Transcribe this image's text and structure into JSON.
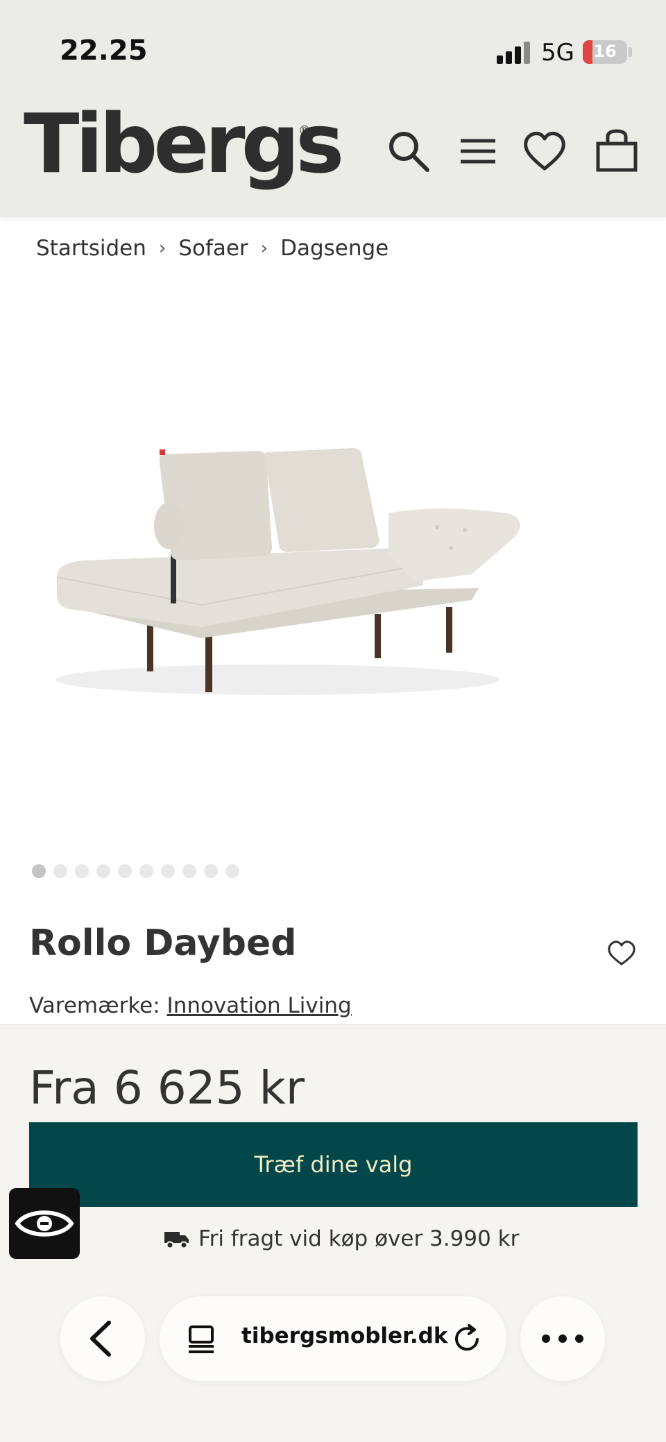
{
  "status_bar": {
    "time": "22.25",
    "network": "5G",
    "battery": "16"
  },
  "header": {
    "logo": "Tibergs",
    "logo_mark": "®"
  },
  "breadcrumb": [
    "Startsiden",
    "Sofaer",
    "Dagsenge"
  ],
  "product": {
    "title": "Rollo Daybed",
    "brand_label": "Varemærke:",
    "brand_name": "Innovation Living",
    "price": "Fra 6 625 kr",
    "cta_label": "Træf dine valg",
    "shipping_text": "Fri fragt vid køp øver 3.990 kr",
    "image_count": 10,
    "active_image": 1
  },
  "browser": {
    "url": "tibergsmobler.dk"
  },
  "colors": {
    "header_bg": "#ecece6",
    "cta_bg": "#04474a",
    "cta_text": "#f1ecc6"
  }
}
